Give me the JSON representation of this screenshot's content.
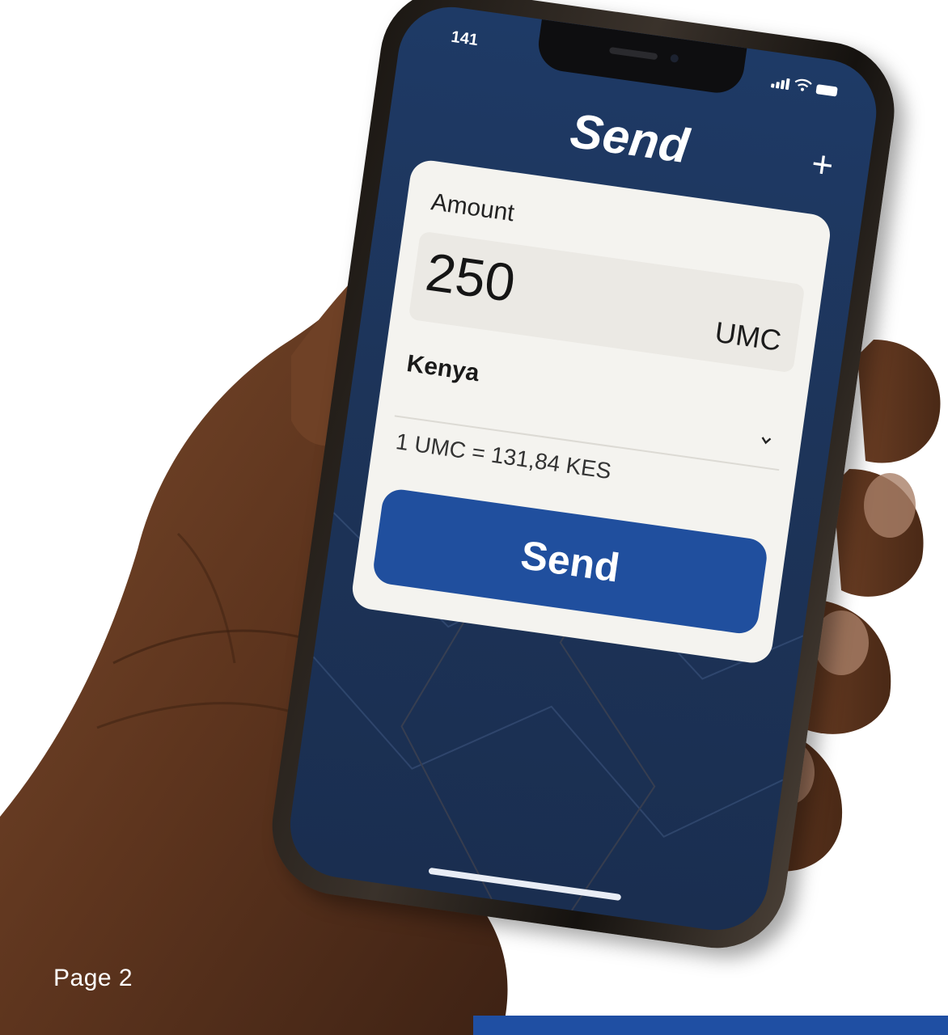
{
  "status_bar": {
    "time": "141"
  },
  "screen": {
    "title": "Send",
    "add_label": "+"
  },
  "form": {
    "amount_label": "Amount",
    "amount_value": "250",
    "currency": "UMC",
    "country": "Kenya",
    "rate": "1 UMC = 131,84 KES",
    "send_label": "Send"
  },
  "page": {
    "label": "Page 2"
  },
  "colors": {
    "screen_bg": "#1e3a66",
    "button": "#204f9e",
    "footer_bar": "#1f4fa3",
    "card": "#f4f3ef"
  },
  "icons": [
    "signal-icon",
    "wifi-icon",
    "battery-icon",
    "chevron-down-icon",
    "plus-icon"
  ]
}
